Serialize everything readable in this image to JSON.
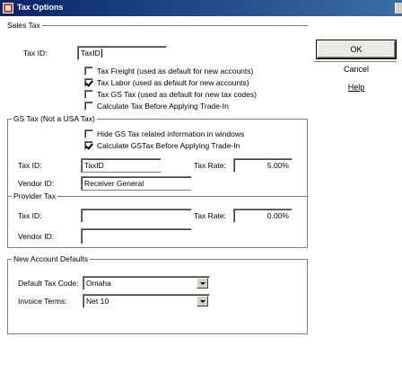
{
  "window": {
    "title": "Tax Options"
  },
  "buttons": {
    "ok": "OK",
    "cancel": "Cancel",
    "help": "Help"
  },
  "sales_tax": {
    "group_title": "Sales Tax",
    "tax_id_label": "Tax ID:",
    "tax_id_value": "TaxID",
    "options": [
      {
        "label": "Tax Freight (used as default for new accounts)",
        "checked": false
      },
      {
        "label": "Tax Labor (used as default for new accounts)",
        "checked": true
      },
      {
        "label": "Tax GS Tax (used as default for new tax codes)",
        "checked": false
      },
      {
        "label": "Calculate Tax Before Applying Trade-In",
        "checked": false
      }
    ]
  },
  "gs_tax": {
    "group_title": "GS Tax (Not a USA Tax)",
    "options": [
      {
        "label": "Hide GS Tax related information in windows",
        "checked": false
      },
      {
        "label": "Calculate GSTax Before Applying Trade-In",
        "checked": true
      }
    ],
    "tax_id_label": "Tax ID:",
    "tax_id_value": "TaxID",
    "tax_rate_label": "Tax Rate:",
    "tax_rate_value": "5.00%",
    "vendor_id_label": "Vendor ID:",
    "vendor_id_value": "Receiver General"
  },
  "provider_tax": {
    "group_title": "Provider Tax",
    "tax_id_label": "Tax ID:",
    "tax_id_value": "",
    "tax_rate_label": "Tax Rate:",
    "tax_rate_value": "0.00%",
    "vendor_id_label": "Vendor ID:",
    "vendor_id_value": ""
  },
  "new_account_defaults": {
    "group_title": "New Account Defaults",
    "default_tax_code_label": "Default Tax Code:",
    "default_tax_code_value": "Omaha",
    "invoice_terms_label": "Invoice Terms:",
    "invoice_terms_value": "Net 10"
  }
}
